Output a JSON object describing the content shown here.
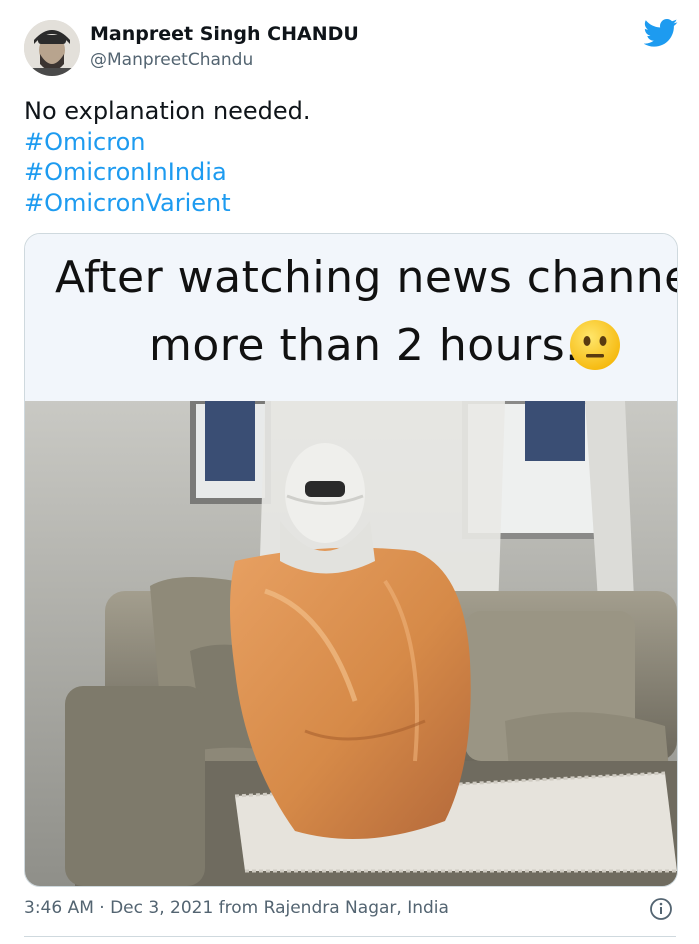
{
  "author": {
    "name": "Manpreet Singh CHANDU",
    "handle": "@ManpreetChandu"
  },
  "tweet": {
    "text": "No explanation needed.",
    "hashtags": [
      "#Omicron",
      "#OmicronInIndia",
      "#OmicronVarient"
    ]
  },
  "media": {
    "caption_line1": "After watching news channel",
    "caption_line2": "more than 2 hours.",
    "emoji": "neutral-face-icon"
  },
  "meta": {
    "timestamp": "3:46 AM · Dec 3, 2021 from Rajendra Nagar, India"
  },
  "colors": {
    "link": "#1d9bf0",
    "twitter_blue": "#1d9bf0",
    "secondary_text": "#536471"
  }
}
